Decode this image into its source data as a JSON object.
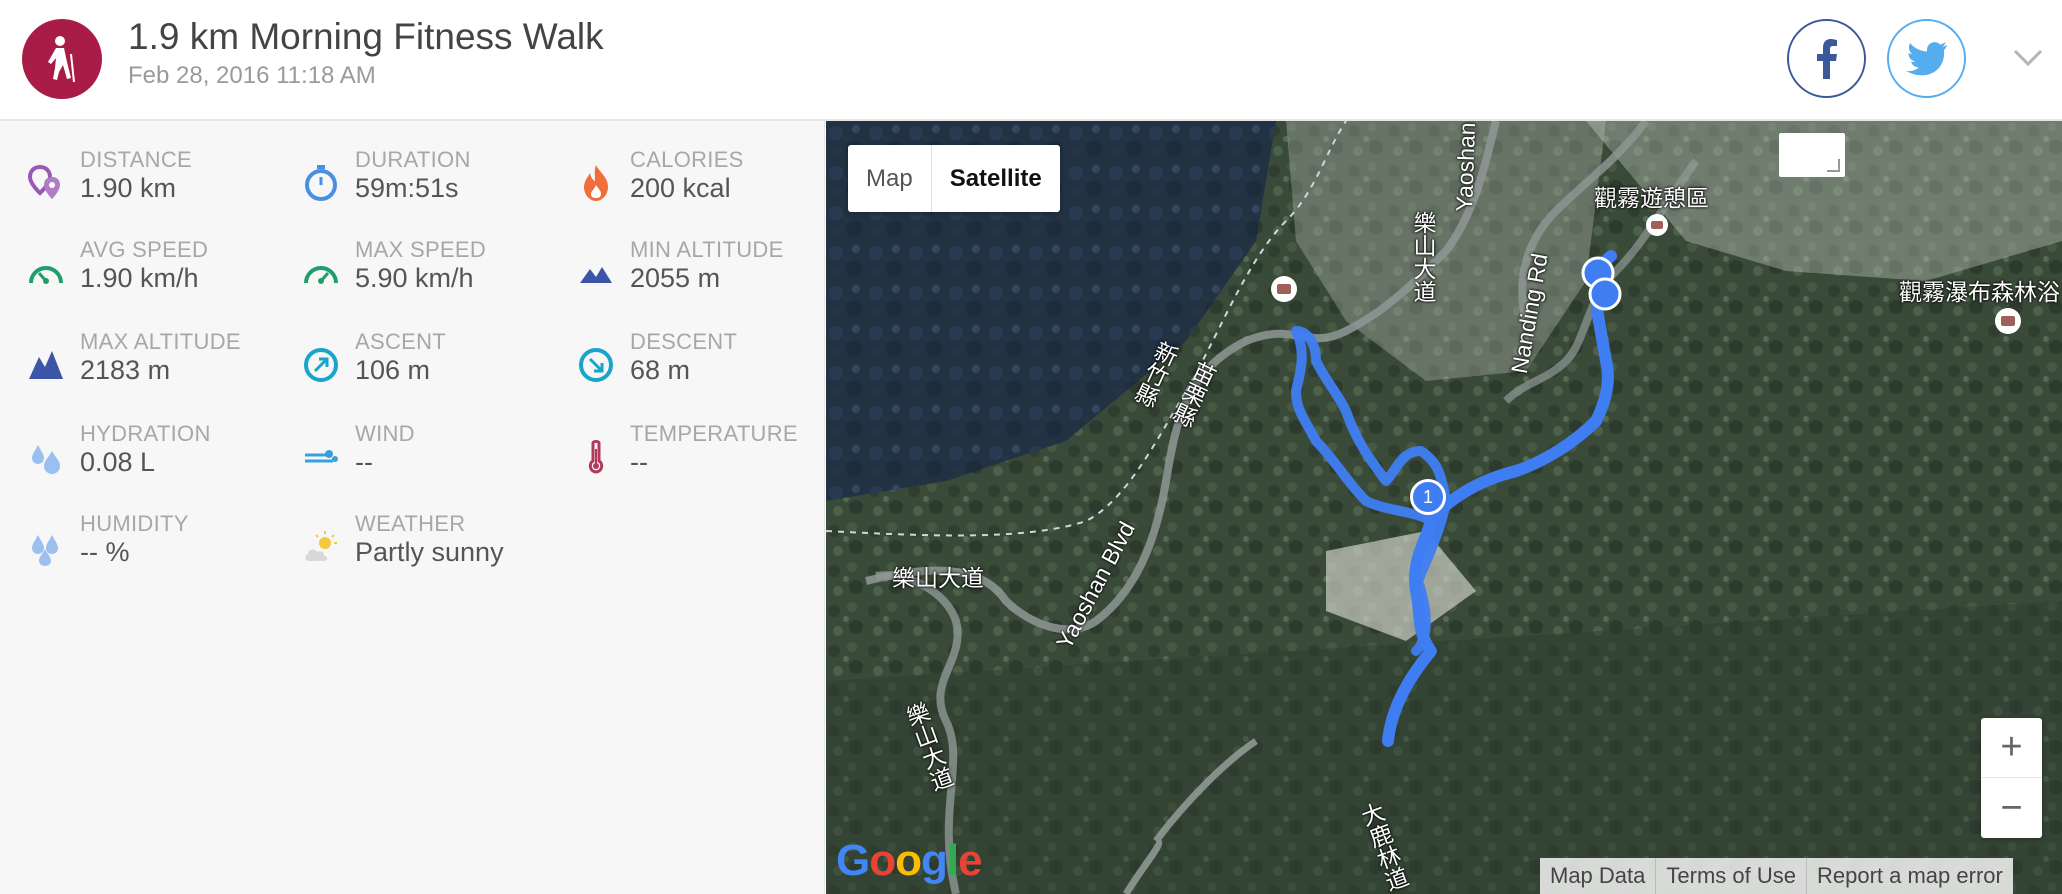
{
  "header": {
    "title": "1.9 km Morning Fitness Walk",
    "date": "Feb 28, 2016 11:18 AM"
  },
  "stats": [
    {
      "label": "DISTANCE",
      "value": "1.90 km",
      "icon": "distance-pin-icon"
    },
    {
      "label": "DURATION",
      "value": "59m:51s",
      "icon": "stopwatch-icon"
    },
    {
      "label": "CALORIES",
      "value": "200 kcal",
      "icon": "flame-icon"
    },
    {
      "label": "AVG SPEED",
      "value": "1.90 km/h",
      "icon": "speedometer-icon"
    },
    {
      "label": "MAX SPEED",
      "value": "5.90 km/h",
      "icon": "speedometer-icon"
    },
    {
      "label": "MIN ALTITUDE",
      "value": "2055 m",
      "icon": "mountain-icon"
    },
    {
      "label": "MAX ALTITUDE",
      "value": "2183 m",
      "icon": "mountain-icon"
    },
    {
      "label": "ASCENT",
      "value": "106 m",
      "icon": "ascent-arrow-icon"
    },
    {
      "label": "DESCENT",
      "value": "68 m",
      "icon": "descent-arrow-icon"
    },
    {
      "label": "HYDRATION",
      "value": "0.08 L",
      "icon": "water-drops-icon"
    },
    {
      "label": "WIND",
      "value": "--",
      "icon": "wind-icon"
    },
    {
      "label": "TEMPERATURE",
      "value": "--",
      "icon": "thermometer-icon"
    },
    {
      "label": "HUMIDITY",
      "value": "-- %",
      "icon": "water-drops-icon"
    },
    {
      "label": "WEATHER",
      "value": "Partly sunny",
      "icon": "partly-sunny-icon"
    }
  ],
  "map": {
    "type_map": "Map",
    "type_satellite": "Satellite",
    "zoom_in": "+",
    "zoom_out": "−",
    "footer": [
      "Map Data",
      "Terms of Use",
      "Report a map error"
    ],
    "google": "Google",
    "labels": {
      "yaoshan_top": "Yaoshan Bl",
      "guanwu": "觀霧遊憩區",
      "yueshan1": "樂山大道",
      "nanding": "Nanding Rd",
      "guanwu_forest": "觀霧瀑布森林浴",
      "hsinchu": "新竹縣",
      "miaoli": "苗栗縣",
      "yaoshan_blvd": "Yaoshan Blvd",
      "yueshan2": "樂山大道",
      "yueshan3": "樂山大道",
      "daluk": "大鹿林道"
    },
    "lap_marker": "1"
  },
  "colors": {
    "brand": "#a81c47",
    "route": "#3f7df2",
    "facebook": "#3b5998",
    "twitter": "#55acee"
  }
}
